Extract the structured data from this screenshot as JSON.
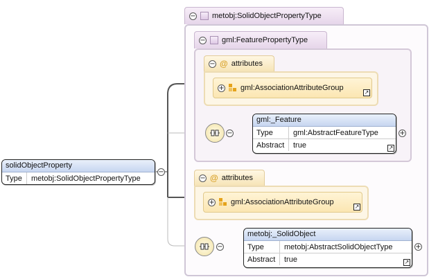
{
  "root": {
    "name": "solidObjectProperty",
    "type_key": "Type",
    "type_value": "metobj:SolidObjectPropertyType"
  },
  "outer_group": {
    "title": "metobj:SolidObjectPropertyType"
  },
  "inner_group": {
    "title": "gml:FeaturePropertyType"
  },
  "inner_attributes": {
    "label": "attributes",
    "group_ref": "gml:AssociationAttributeGroup"
  },
  "feature": {
    "name": "gml:_Feature",
    "type_key": "Type",
    "type_value": "gml:AbstractFeatureType",
    "abstract_key": "Abstract",
    "abstract_value": "true"
  },
  "outer_attributes": {
    "label": "attributes",
    "group_ref": "gml:AssociationAttributeGroup"
  },
  "solid_object": {
    "name": "metobj:_SolidObject",
    "type_key": "Type",
    "type_value": "metobj:AbstractSolidObjectType",
    "abstract_key": "Abstract",
    "abstract_value": "true"
  },
  "glyphs": {
    "minus": "−",
    "plus": "+",
    "at": "@",
    "link": "↗"
  },
  "colors": {
    "element_header": "#c7d6f0",
    "attribute_fill": "#fbe6b2",
    "group_tab": "#e6d6ea"
  }
}
